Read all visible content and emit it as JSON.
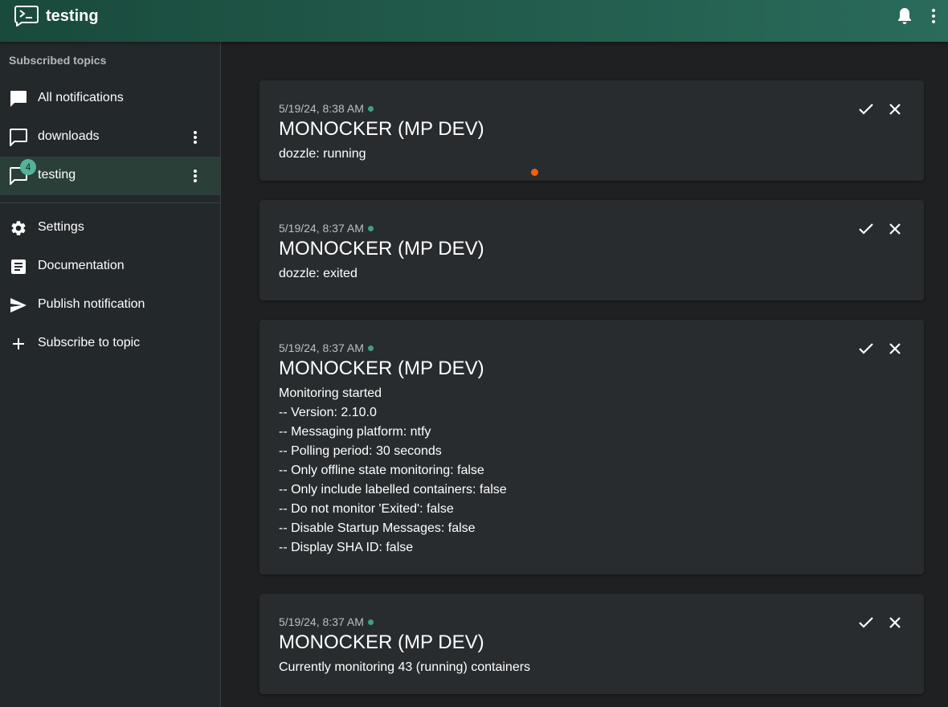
{
  "app": {
    "title": "testing",
    "logo_icon": "terminal-icon",
    "accent": "#2a6b5b"
  },
  "topbar": {
    "icons": [
      "bell-icon",
      "more-vert-icon"
    ]
  },
  "sidebar": {
    "header": "Subscribed topics",
    "topics": [
      {
        "label": "All notifications",
        "icon": "chat-filled-icon"
      },
      {
        "label": "downloads",
        "icon": "chat-outline-icon"
      },
      {
        "label": "testing",
        "icon": "chat-outline-icon",
        "badge": "4",
        "active": true
      }
    ],
    "links": [
      {
        "label": "Settings",
        "icon": "gear-icon"
      },
      {
        "label": "Documentation",
        "icon": "document-icon"
      },
      {
        "label": "Publish notification",
        "icon": "send-icon"
      },
      {
        "label": "Subscribe to topic",
        "icon": "plus-icon"
      }
    ]
  },
  "notifications": [
    {
      "time": "5/19/24, 8:38 AM",
      "title": "MONOCKER (MP DEV)",
      "lines": [
        "dozzle: running"
      ]
    },
    {
      "time": "5/19/24, 8:37 AM",
      "title": "MONOCKER (MP DEV)",
      "lines": [
        "dozzle: exited"
      ]
    },
    {
      "time": "5/19/24, 8:37 AM",
      "title": "MONOCKER (MP DEV)",
      "lines": [
        "Monitoring started",
        "-- Version: 2.10.0",
        "-- Messaging platform: ntfy",
        "-- Polling period: 30 seconds",
        "-- Only offline state monitoring: false",
        "-- Only include labelled containers: false",
        "-- Do not monitor 'Exited': false",
        "-- Disable Startup Messages: false",
        "-- Display SHA ID: false"
      ]
    },
    {
      "time": "5/19/24, 8:37 AM",
      "title": "MONOCKER (MP DEV)",
      "lines": [
        "Currently monitoring 43 (running) containers"
      ]
    }
  ]
}
